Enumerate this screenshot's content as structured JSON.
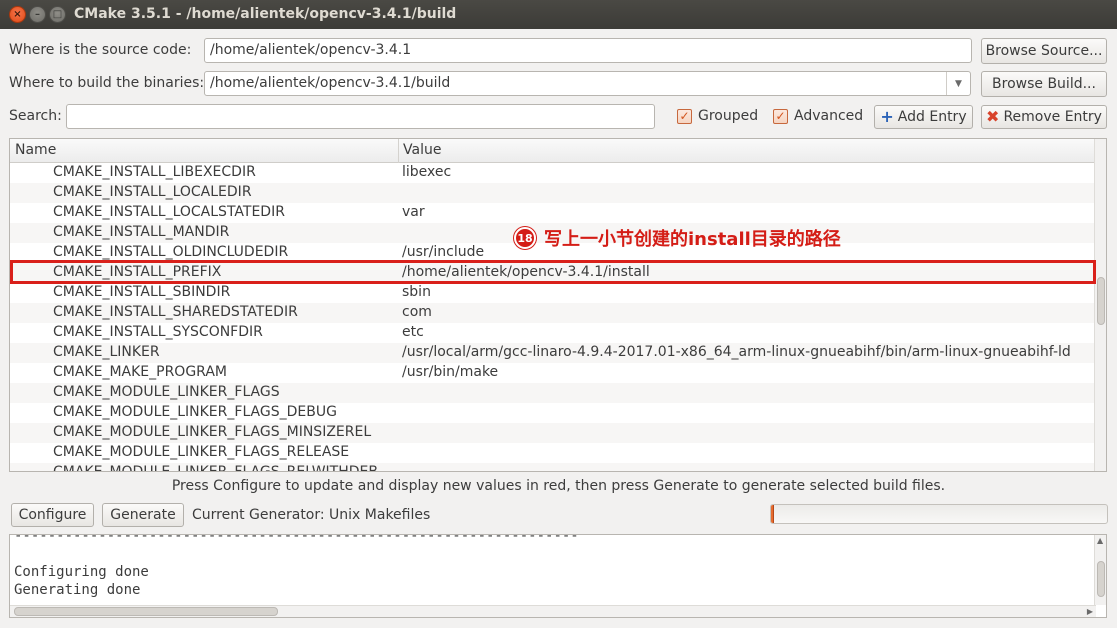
{
  "window": {
    "title": "CMake 3.5.1 - /home/alientek/opencv-3.4.1/build"
  },
  "source": {
    "label": "Where is the source code:",
    "value": "/home/alientek/opencv-3.4.1",
    "browse_label": "Browse Source..."
  },
  "build": {
    "label": "Where to build the binaries:",
    "value": "/home/alientek/opencv-3.4.1/build",
    "browse_label": "Browse Build..."
  },
  "search": {
    "label": "Search:",
    "value": ""
  },
  "options": {
    "grouped": "Grouped",
    "advanced": "Advanced",
    "add_entry": "Add Entry",
    "remove_entry": "Remove Entry"
  },
  "table": {
    "headers": {
      "name": "Name",
      "value": "Value"
    },
    "rows": [
      {
        "name": "CMAKE_INSTALL_LIBEXECDIR",
        "value": "libexec"
      },
      {
        "name": "CMAKE_INSTALL_LOCALEDIR",
        "value": ""
      },
      {
        "name": "CMAKE_INSTALL_LOCALSTATEDIR",
        "value": "var"
      },
      {
        "name": "CMAKE_INSTALL_MANDIR",
        "value": ""
      },
      {
        "name": "CMAKE_INSTALL_OLDINCLUDEDIR",
        "value": "/usr/include"
      },
      {
        "name": "CMAKE_INSTALL_PREFIX",
        "value": "/home/alientek/opencv-3.4.1/install"
      },
      {
        "name": "CMAKE_INSTALL_SBINDIR",
        "value": "sbin"
      },
      {
        "name": "CMAKE_INSTALL_SHAREDSTATEDIR",
        "value": "com"
      },
      {
        "name": "CMAKE_INSTALL_SYSCONFDIR",
        "value": "etc"
      },
      {
        "name": "CMAKE_LINKER",
        "value": "/usr/local/arm/gcc-linaro-4.9.4-2017.01-x86_64_arm-linux-gnueabihf/bin/arm-linux-gnueabihf-ld"
      },
      {
        "name": "CMAKE_MAKE_PROGRAM",
        "value": "/usr/bin/make"
      },
      {
        "name": "CMAKE_MODULE_LINKER_FLAGS",
        "value": ""
      },
      {
        "name": "CMAKE_MODULE_LINKER_FLAGS_DEBUG",
        "value": ""
      },
      {
        "name": "CMAKE_MODULE_LINKER_FLAGS_MINSIZEREL",
        "value": ""
      },
      {
        "name": "CMAKE_MODULE_LINKER_FLAGS_RELEASE",
        "value": ""
      },
      {
        "name": "CMAKE_MODULE_LINKER_FLAGS_RELWITHDEB",
        "value": ""
      }
    ]
  },
  "annotation": {
    "number": "18",
    "text": "写上一小节创建的install目录的路径"
  },
  "status_text": "Press Configure to update and display new values in red, then press Generate to generate selected build files.",
  "actions": {
    "configure": "Configure",
    "generate": "Generate",
    "generator": "Current Generator: Unix Makefiles"
  },
  "progress": {
    "fraction": 0.01,
    "color": "#e66b2e"
  },
  "output": {
    "lines": [
      "-------------------------------------------------------------------",
      "",
      "Configuring done",
      "Generating done"
    ]
  }
}
